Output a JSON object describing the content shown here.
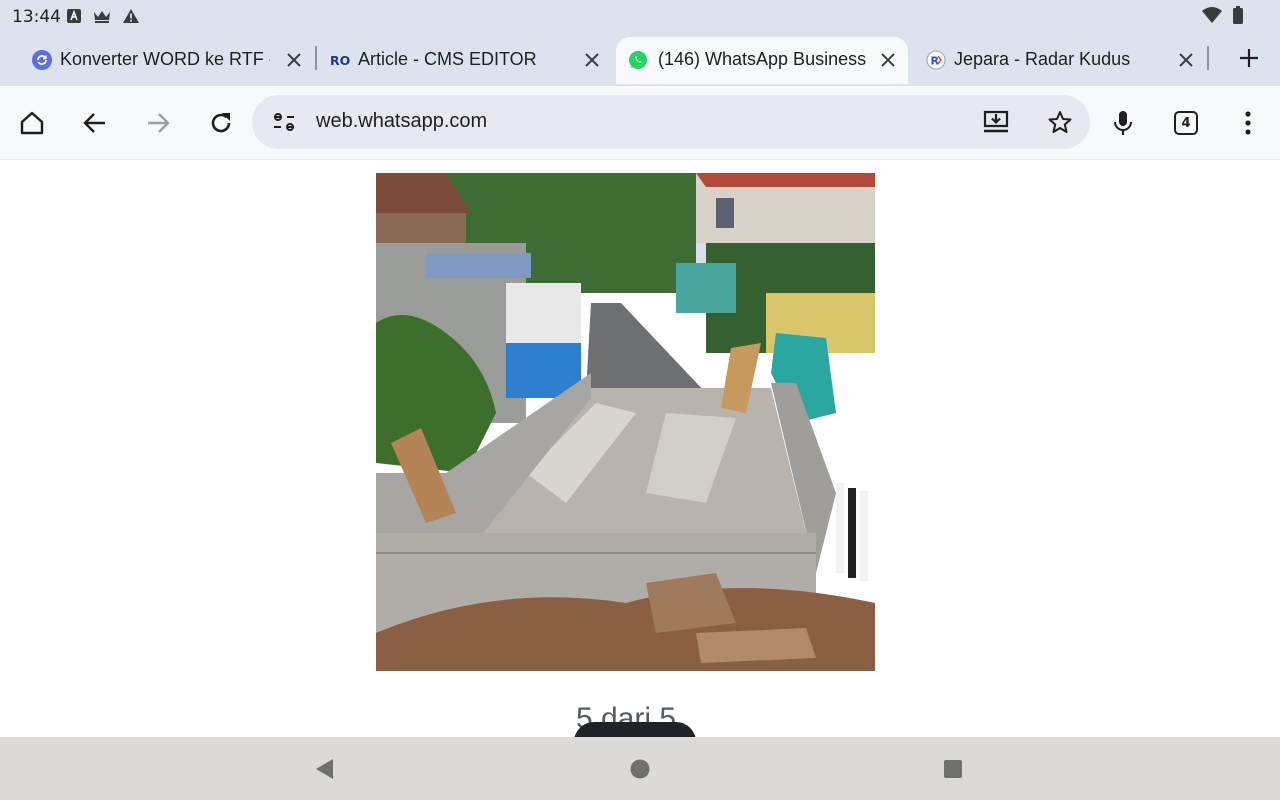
{
  "status_bar": {
    "time": "13:44",
    "left_icons": [
      "text-a-icon",
      "crown-icon",
      "warning-icon"
    ],
    "right_icons": [
      "wifi-icon",
      "battery-icon"
    ]
  },
  "tabs": [
    {
      "title": "Konverter WORD ke RTF -",
      "favicon": "converter-icon",
      "active": false
    },
    {
      "title": "Article - CMS EDITOR",
      "favicon": "ro-logo-icon",
      "active": false
    },
    {
      "title": "(146) WhatsApp Business",
      "favicon": "whatsapp-icon",
      "active": true
    },
    {
      "title": "Jepara - Radar Kudus",
      "favicon": "radar-kudus-icon",
      "active": false
    }
  ],
  "toolbar": {
    "url": "web.whatsapp.com",
    "tab_count": "4"
  },
  "content": {
    "pager": "5 dari 5"
  },
  "colors": {
    "chrome_bg": "#dde3ee",
    "active_tab": "#f8f9fd",
    "omnibox": "#e6e9f1",
    "whatsapp": "#25d366",
    "nav_bar": "#dcdad6"
  }
}
